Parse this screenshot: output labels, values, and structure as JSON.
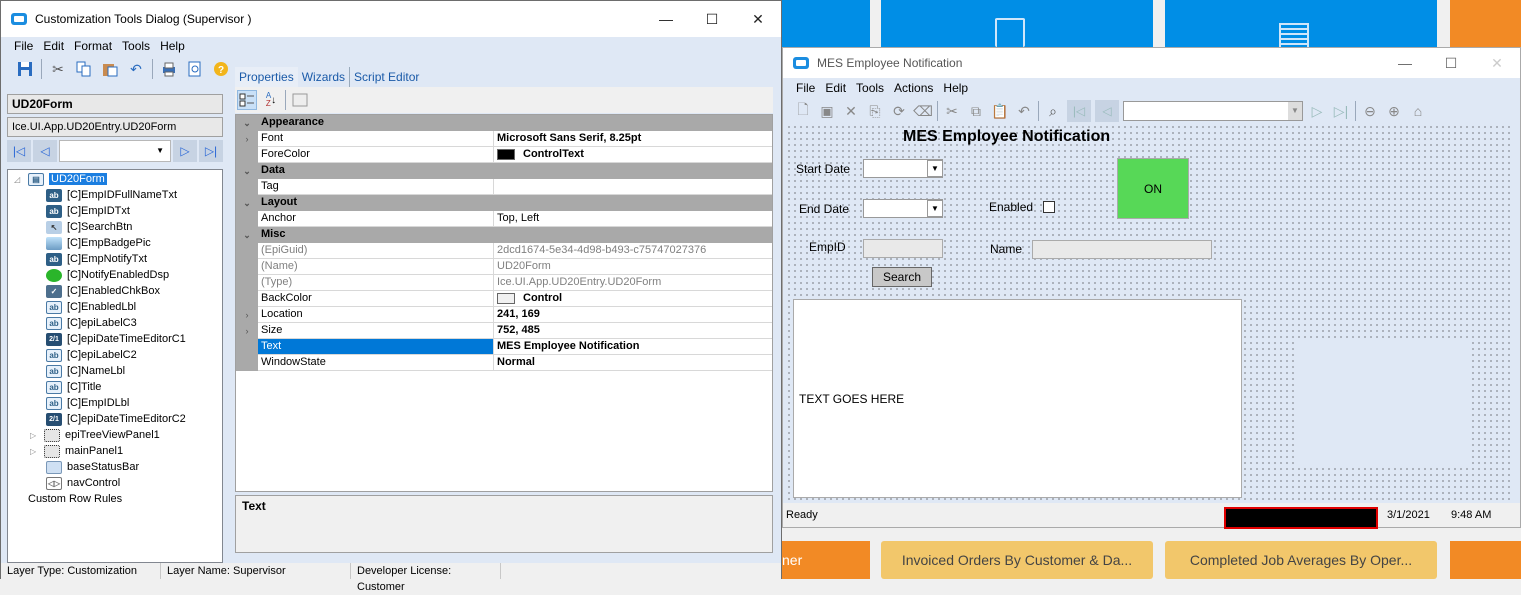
{
  "background": {
    "tiles_top": [
      {
        "icon": "documents-icon"
      },
      {
        "icon": "list-view-icon"
      }
    ],
    "tiles_bottom": [
      {
        "label": "ner",
        "color": "#f28a25"
      },
      {
        "label": "Invoiced Orders By Customer & Da...",
        "color": "#f2c76b"
      },
      {
        "label": "Completed Job Averages By Oper...",
        "color": "#f2c76b"
      }
    ],
    "blue": "#008ee6",
    "orange": "#f28a25"
  },
  "customization_dialog": {
    "title": "Customization Tools Dialog  (Supervisor )",
    "window_buttons": {
      "minimize": "—",
      "maximize": "☐",
      "close": "✕"
    },
    "menu": [
      "File",
      "Edit",
      "Format",
      "Tools",
      "Help"
    ],
    "toolbar_icons": [
      "save-icon",
      "cut-icon",
      "copy-icon",
      "paste-icon",
      "undo-icon",
      "print-icon",
      "print-preview-icon",
      "help-icon"
    ],
    "form_name": "UD20Form",
    "form_type": "Ice.UI.App.UD20Entry.UD20Form",
    "tree": {
      "root": "UD20Form",
      "children": [
        {
          "label": "[C]EmpIDFullNameTxt",
          "icon": "textbox-icon"
        },
        {
          "label": "[C]EmpIDTxt",
          "icon": "textbox-icon"
        },
        {
          "label": "[C]SearchBtn",
          "icon": "button-icon"
        },
        {
          "label": "[C]EmpBadgePic",
          "icon": "picture-icon"
        },
        {
          "label": "[C]EmpNotifyTxt",
          "icon": "textbox-icon"
        },
        {
          "label": "[C]NotifyEnabledDsp",
          "icon": "led-icon"
        },
        {
          "label": "[C]EnabledChkBox",
          "icon": "checkbox-icon"
        },
        {
          "label": "[C]EnabledLbl",
          "icon": "label-icon"
        },
        {
          "label": "[C]epiLabelC3",
          "icon": "label-icon"
        },
        {
          "label": "[C]epiDateTimeEditorC1",
          "icon": "date-editor-icon"
        },
        {
          "label": "[C]epiLabelC2",
          "icon": "label-icon"
        },
        {
          "label": "[C]NameLbl",
          "icon": "label-icon"
        },
        {
          "label": "[C]Title",
          "icon": "label-icon"
        },
        {
          "label": "[C]EmpIDLbl",
          "icon": "label-icon"
        },
        {
          "label": "[C]epiDateTimeEditorC2",
          "icon": "date-editor-icon"
        },
        {
          "label": "epiTreeViewPanel1",
          "icon": "panel-icon",
          "expandable": true
        },
        {
          "label": "mainPanel1",
          "icon": "panel-icon",
          "expandable": true
        },
        {
          "label": "baseStatusBar",
          "icon": "statusbar-icon"
        },
        {
          "label": "navControl",
          "icon": "nav-control-icon"
        }
      ],
      "footer": "Custom Row Rules"
    },
    "tabs": [
      "Properties",
      "Wizards",
      "Script Editor"
    ],
    "active_tab": "Properties",
    "properties": [
      {
        "category": "Appearance"
      },
      {
        "name": "Font",
        "value": "Microsoft Sans Serif, 8.25pt",
        "bold": true,
        "expandable": true
      },
      {
        "name": "ForeColor",
        "value": "ControlText",
        "bold": true,
        "swatch": "#000000"
      },
      {
        "category": "Data"
      },
      {
        "name": "Tag",
        "value": ""
      },
      {
        "category": "Layout"
      },
      {
        "name": "Anchor",
        "value": "Top, Left"
      },
      {
        "category": "Misc"
      },
      {
        "name": "(EpiGuid)",
        "value": "2dcd1674-5e34-4d98-b493-c75747027376",
        "readonly": true
      },
      {
        "name": "(Name)",
        "value": "UD20Form",
        "readonly": true
      },
      {
        "name": "(Type)",
        "value": "Ice.UI.App.UD20Entry.UD20Form",
        "readonly": true
      },
      {
        "name": "BackColor",
        "value": "Control",
        "bold": true,
        "swatch": "#f0f0f0"
      },
      {
        "name": "Location",
        "value": "241, 169",
        "bold": true,
        "expandable": true
      },
      {
        "name": "Size",
        "value": "752, 485",
        "bold": true,
        "expandable": true
      },
      {
        "name": "Text",
        "value": "MES Employee Notification",
        "bold": true,
        "selected": true
      },
      {
        "name": "WindowState",
        "value": "Normal",
        "bold": true
      }
    ],
    "description_title": "Text",
    "status": {
      "layer_type": "Layer Type:  Customization",
      "layer_name": "Layer Name:  Supervisor",
      "license": "Developer License:  Customer"
    }
  },
  "mes_window": {
    "title": "MES Employee Notification",
    "window_buttons": {
      "minimize": "—",
      "maximize": "☐",
      "close": "✕"
    },
    "menu": [
      "File",
      "Edit",
      "Tools",
      "Actions",
      "Help"
    ],
    "form_title": "MES Employee Notification",
    "start_date_label": "Start Date",
    "end_date_label": "End Date",
    "enabled_label": "Enabled",
    "enabled_checked": false,
    "on_indicator": "ON",
    "on_color": "#57d857",
    "empid_label": "EmpID",
    "empid_value": "",
    "name_label": "Name",
    "name_value": "",
    "search_label": "Search",
    "notify_text": "TEXT GOES HERE",
    "status": {
      "text": "Ready",
      "date": "3/1/2021",
      "time": "9:48 AM"
    }
  }
}
